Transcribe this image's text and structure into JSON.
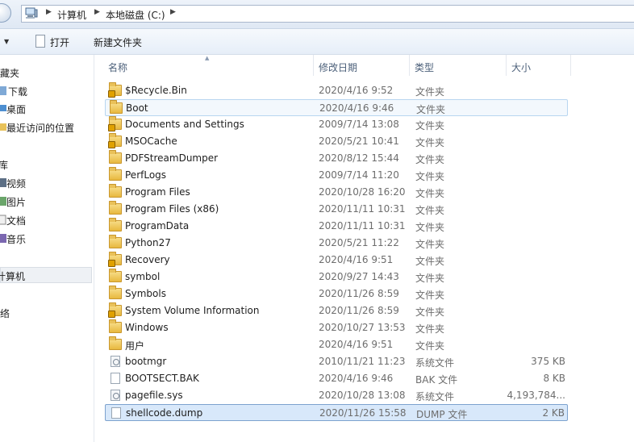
{
  "address": {
    "crumbs": [
      "计算机",
      "本地磁盘 (C:)"
    ]
  },
  "toolbar": {
    "open_label": "打开",
    "new_folder_label": "新建文件夹"
  },
  "nav": {
    "favorites": "收藏夹",
    "downloads": "下载",
    "desktop": "桌面",
    "recent": "最近访问的位置",
    "libraries": "库",
    "videos": "视频",
    "pictures": "图片",
    "documents": "文档",
    "music": "音乐",
    "computer": "计算机",
    "network": "网络"
  },
  "columns": {
    "name": "名称",
    "date": "修改日期",
    "type": "类型",
    "size": "大小"
  },
  "files": [
    {
      "name": "$Recycle.Bin",
      "date": "2020/4/16 9:52",
      "type": "文件夹",
      "size": "",
      "icon": "locked-folder-icon"
    },
    {
      "name": "Boot",
      "date": "2020/4/16 9:46",
      "type": "文件夹",
      "size": "",
      "icon": "folder-icon"
    },
    {
      "name": "Documents and Settings",
      "date": "2009/7/14 13:08",
      "type": "文件夹",
      "size": "",
      "icon": "locked-folder-icon"
    },
    {
      "name": "MSOCache",
      "date": "2020/5/21 10:41",
      "type": "文件夹",
      "size": "",
      "icon": "locked-folder-icon"
    },
    {
      "name": "PDFStreamDumper",
      "date": "2020/8/12 15:44",
      "type": "文件夹",
      "size": "",
      "icon": "folder-icon"
    },
    {
      "name": "PerfLogs",
      "date": "2009/7/14 11:20",
      "type": "文件夹",
      "size": "",
      "icon": "folder-icon"
    },
    {
      "name": "Program Files",
      "date": "2020/10/28 16:20",
      "type": "文件夹",
      "size": "",
      "icon": "folder-icon"
    },
    {
      "name": "Program Files (x86)",
      "date": "2020/11/11 10:31",
      "type": "文件夹",
      "size": "",
      "icon": "folder-icon"
    },
    {
      "name": "ProgramData",
      "date": "2020/11/11 10:31",
      "type": "文件夹",
      "size": "",
      "icon": "folder-icon"
    },
    {
      "name": "Python27",
      "date": "2020/5/21 11:22",
      "type": "文件夹",
      "size": "",
      "icon": "folder-icon"
    },
    {
      "name": "Recovery",
      "date": "2020/4/16 9:51",
      "type": "文件夹",
      "size": "",
      "icon": "locked-folder-icon"
    },
    {
      "name": "symbol",
      "date": "2020/9/27 14:43",
      "type": "文件夹",
      "size": "",
      "icon": "folder-icon"
    },
    {
      "name": "Symbols",
      "date": "2020/11/26 8:59",
      "type": "文件夹",
      "size": "",
      "icon": "folder-icon"
    },
    {
      "name": "System Volume Information",
      "date": "2020/11/26 8:59",
      "type": "文件夹",
      "size": "",
      "icon": "locked-folder-icon"
    },
    {
      "name": "Windows",
      "date": "2020/10/27 13:53",
      "type": "文件夹",
      "size": "",
      "icon": "folder-icon"
    },
    {
      "name": "用户",
      "date": "2020/4/16 9:51",
      "type": "文件夹",
      "size": "",
      "icon": "folder-icon"
    },
    {
      "name": "bootmgr",
      "date": "2010/11/21 11:23",
      "type": "系统文件",
      "size": "375 KB",
      "icon": "system-file-icon"
    },
    {
      "name": "BOOTSECT.BAK",
      "date": "2020/4/16 9:46",
      "type": "BAK 文件",
      "size": "8 KB",
      "icon": "file-icon"
    },
    {
      "name": "pagefile.sys",
      "date": "2020/10/28 13:08",
      "type": "系统文件",
      "size": "4,193,784...",
      "icon": "system-file-icon"
    },
    {
      "name": "shellcode.dump",
      "date": "2020/11/26 15:58",
      "type": "DUMP 文件",
      "size": "2 KB",
      "icon": "file-icon"
    }
  ],
  "hovered_row": "Boot",
  "selected_row": "shellcode.dump"
}
